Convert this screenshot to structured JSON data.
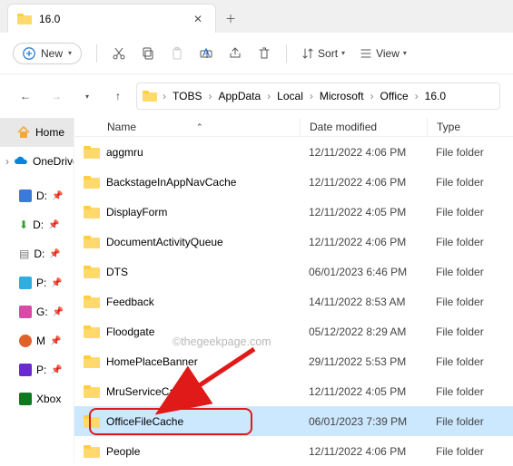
{
  "tab": {
    "title": "16.0"
  },
  "toolbar": {
    "new": "New",
    "sort": "Sort",
    "view": "View"
  },
  "breadcrumbs": [
    "TOBS",
    "AppData",
    "Local",
    "Microsoft",
    "Office",
    "16.0"
  ],
  "columns": {
    "name": "Name",
    "date": "Date modified",
    "type": "Type"
  },
  "sidebar": {
    "home": "Home",
    "onedrive": "OneDrive",
    "pins": [
      "D:",
      "D:",
      "D:",
      "P:",
      "G:",
      "M",
      "P:",
      "Xbox"
    ]
  },
  "rows": [
    {
      "name": "aggmru",
      "date": "12/11/2022 4:06 PM",
      "type": "File folder",
      "selected": false
    },
    {
      "name": "BackstageInAppNavCache",
      "date": "12/11/2022 4:06 PM",
      "type": "File folder",
      "selected": false
    },
    {
      "name": "DisplayForm",
      "date": "12/11/2022 4:05 PM",
      "type": "File folder",
      "selected": false
    },
    {
      "name": "DocumentActivityQueue",
      "date": "12/11/2022 4:06 PM",
      "type": "File folder",
      "selected": false
    },
    {
      "name": "DTS",
      "date": "06/01/2023 6:46 PM",
      "type": "File folder",
      "selected": false
    },
    {
      "name": "Feedback",
      "date": "14/11/2022 8:53 AM",
      "type": "File folder",
      "selected": false
    },
    {
      "name": "Floodgate",
      "date": "05/12/2022 8:29 AM",
      "type": "File folder",
      "selected": false
    },
    {
      "name": "HomePlaceBanner",
      "date": "29/11/2022 5:53 PM",
      "type": "File folder",
      "selected": false
    },
    {
      "name": "MruServiceCache",
      "date": "12/11/2022 4:05 PM",
      "type": "File folder",
      "selected": false
    },
    {
      "name": "OfficeFileCache",
      "date": "06/01/2023 7:39 PM",
      "type": "File folder",
      "selected": true
    },
    {
      "name": "People",
      "date": "12/11/2022 4:06 PM",
      "type": "File folder",
      "selected": false
    }
  ],
  "watermark": "©thegeekpage.com"
}
